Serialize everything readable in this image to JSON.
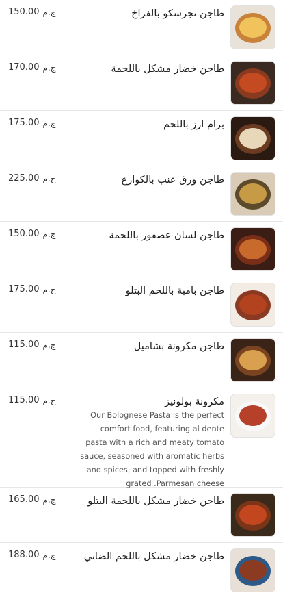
{
  "currency": "ج.م",
  "items": [
    {
      "name": "طاجن تجرسكو بالفراخ",
      "price": "150.00",
      "img": "casserole-chicken-image",
      "colors": {
        "bg": "#e9e2d8",
        "dish": "#c9823a",
        "inner": "#f0c35c"
      }
    },
    {
      "name": "طاجن خضار مشكل باللحمة",
      "price": "170.00",
      "img": "mixed-vegetable-meat-tagine-image",
      "colors": {
        "bg": "#3b2a22",
        "dish": "#8a3a1e",
        "inner": "#c44a22"
      }
    },
    {
      "name": "برام ارز باللحم",
      "price": "175.00",
      "img": "rice-clay-pot-meat-image",
      "colors": {
        "bg": "#2a1a12",
        "dish": "#6b3c22",
        "inner": "#e8d7b8"
      }
    },
    {
      "name": "طاجن ورق عنب بالكوارع",
      "price": "225.00",
      "img": "vine-leaves-trotters-tagine-image",
      "colors": {
        "bg": "#d9cbb5",
        "dish": "#5d4a2a",
        "inner": "#c79a46"
      }
    },
    {
      "name": "طاجن لسان عصفور باللحمة",
      "price": "150.00",
      "img": "orzo-meat-tagine-image",
      "colors": {
        "bg": "#3a1d14",
        "dish": "#7a2e18",
        "inner": "#c86a2c"
      }
    },
    {
      "name": "طاجن بامية باللحم البتلو",
      "price": "175.00",
      "img": "okra-veal-tagine-image",
      "colors": {
        "bg": "#f2ece4",
        "dish": "#8a3a22",
        "inner": "#b3421e"
      }
    },
    {
      "name": "طاجن مكرونة بشاميل",
      "price": "115.00",
      "img": "bechamel-pasta-tagine-image",
      "colors": {
        "bg": "#3a2418",
        "dish": "#7b4420",
        "inner": "#d9a050"
      }
    },
    {
      "name": "مكرونة بولونيز",
      "price": "115.00",
      "img": "bolognese-pasta-image",
      "description": "Our Bolognese Pasta is the perfect comfort food, featuring al dente pasta with a rich and meaty tomato sauce, seasoned with aromatic herbs and spices, and topped with freshly grated .Parmesan cheese",
      "colors": {
        "bg": "#f4f1ec",
        "dish": "#f8f8f8",
        "inner": "#b6402a"
      }
    },
    {
      "name": "طاجن خضار مشكل باللحمة البتلو",
      "price": "165.00",
      "img": "mixed-vegetable-veal-tagine-image",
      "colors": {
        "bg": "#3a2a1c",
        "dish": "#7a3418",
        "inner": "#c2471f"
      }
    },
    {
      "name": "طاجن خضار مشكل باللحم الضاني",
      "price": "188.00",
      "img": "mixed-vegetable-lamb-tagine-image",
      "colors": {
        "bg": "#e8e0d6",
        "dish": "#2e5a8a",
        "inner": "#8a3b22"
      }
    }
  ]
}
